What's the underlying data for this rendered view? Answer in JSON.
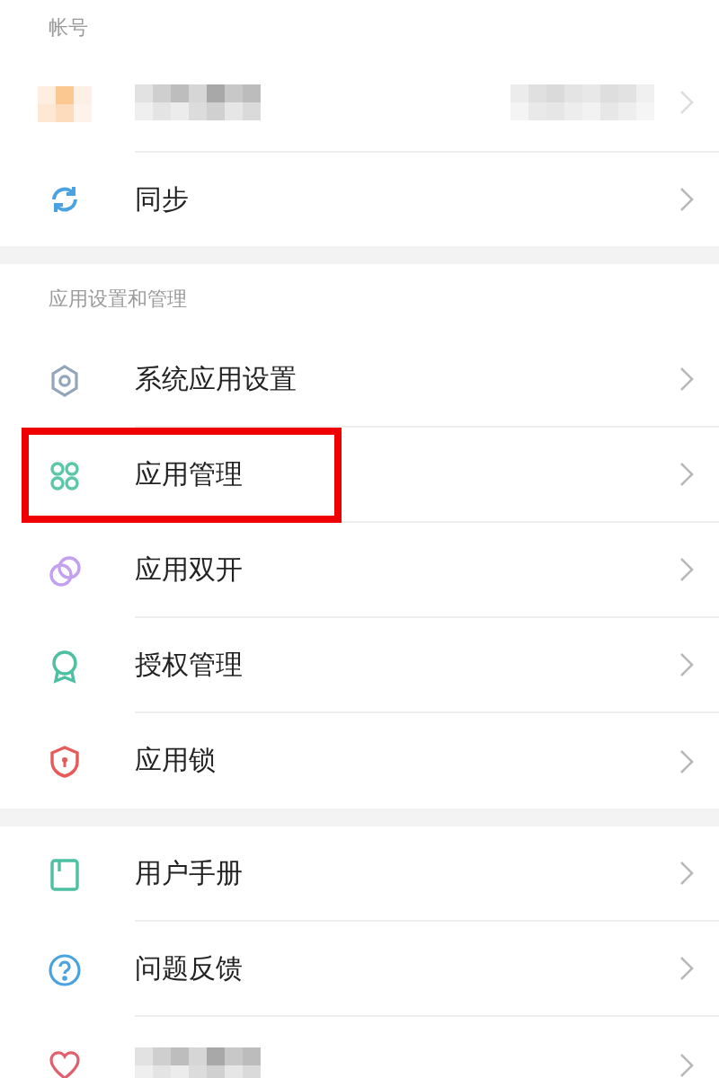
{
  "sections": [
    {
      "header": "帐号",
      "items": [
        {
          "kind": "account",
          "highlighted": false
        },
        {
          "kind": "sync",
          "label": "同步",
          "highlighted": false
        }
      ]
    },
    {
      "header": "应用设置和管理",
      "items": [
        {
          "kind": "gear",
          "label": "系统应用设置",
          "highlighted": false
        },
        {
          "kind": "grid",
          "label": "应用管理",
          "highlighted": true
        },
        {
          "kind": "circles",
          "label": "应用双开",
          "highlighted": false
        },
        {
          "kind": "award",
          "label": "授权管理",
          "highlighted": false
        },
        {
          "kind": "shield",
          "label": "应用锁",
          "highlighted": false
        }
      ]
    },
    {
      "items": [
        {
          "kind": "book",
          "label": "用户手册",
          "highlighted": false
        },
        {
          "kind": "help",
          "label": "问题反馈",
          "highlighted": false
        },
        {
          "kind": "heart",
          "highlighted": false
        }
      ]
    }
  ]
}
